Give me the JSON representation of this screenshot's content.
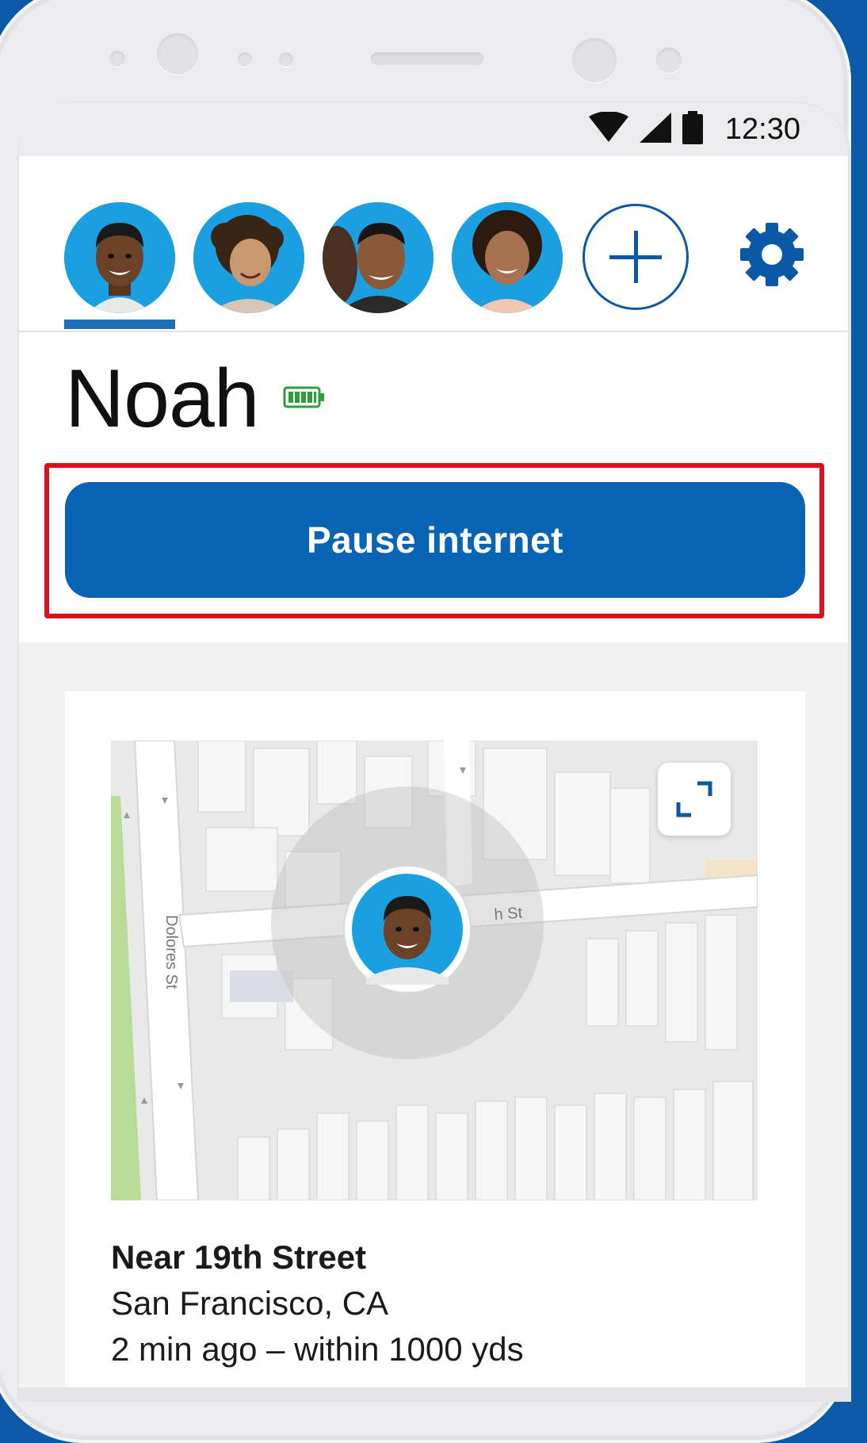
{
  "status_bar": {
    "time": "12:30"
  },
  "profiles": [
    {
      "id": "noah",
      "selected": true
    },
    {
      "id": "child-2",
      "selected": false
    },
    {
      "id": "adult-1",
      "selected": false
    },
    {
      "id": "adult-2",
      "selected": false
    }
  ],
  "header": {
    "child_name": "Noah",
    "battery_level": 1.0
  },
  "actions": {
    "pause_label": "Pause internet"
  },
  "map": {
    "street_dolores": "Dolores St",
    "street_partial": "h St"
  },
  "location": {
    "title": "Near 19th Street",
    "city": "San Francisco, CA",
    "time": "2 min ago – within 1000 yds"
  },
  "colors": {
    "accent": "#0964b6",
    "highlight": "#d9121b",
    "avatar_bg": "#1aa0e0",
    "battery": "#2e9e3b"
  }
}
